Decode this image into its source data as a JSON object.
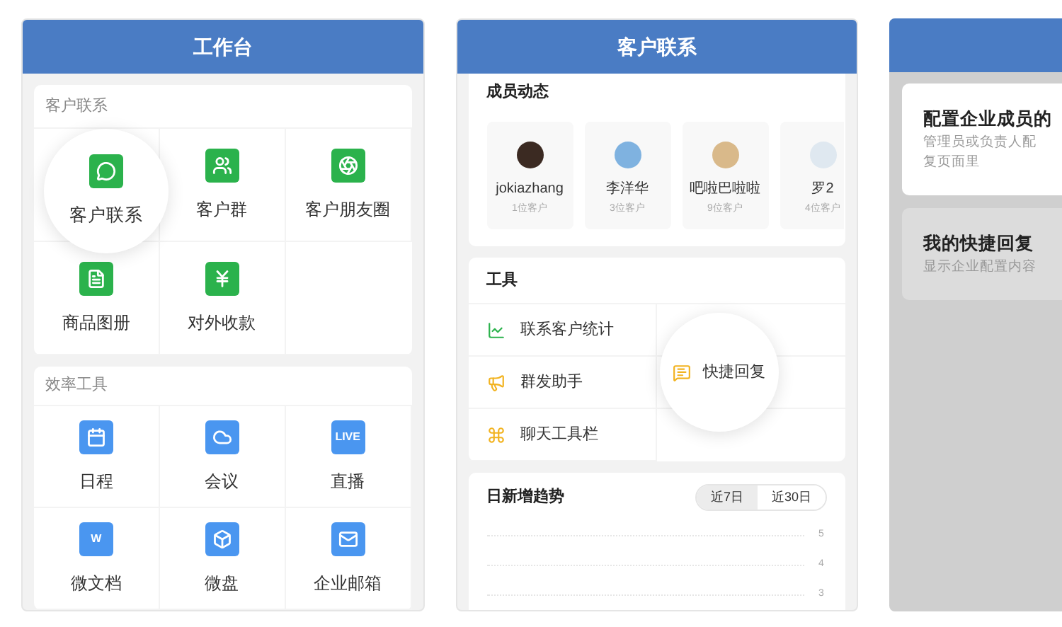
{
  "workbench": {
    "title": "工作台",
    "sections": [
      {
        "heading": "客户联系",
        "items": [
          {
            "label": "客户联系",
            "spotlight": true
          },
          {
            "label": "客户群",
            "spotlight": false
          },
          {
            "label": "客户朋友圈",
            "spotlight": false
          },
          {
            "label": "商品图册",
            "spotlight": false
          },
          {
            "label": "对外收款",
            "spotlight": false
          }
        ]
      },
      {
        "heading": "效率工具",
        "items": [
          {
            "label": "日程",
            "spotlight": false
          },
          {
            "label": "会议",
            "spotlight": false
          },
          {
            "label": "直播",
            "spotlight": false,
            "icon_text": "LIVE"
          },
          {
            "label": "微文档",
            "spotlight": false,
            "icon_text": "W"
          },
          {
            "label": "微盘",
            "spotlight": false
          },
          {
            "label": "企业邮箱",
            "spotlight": false
          }
        ]
      }
    ]
  },
  "customer_contact": {
    "title": "客户联系",
    "members": {
      "heading": "成员动态",
      "items": [
        {
          "name": "jokiazhang",
          "count": "1位客户",
          "color": "#3b2a22"
        },
        {
          "name": "李洋华",
          "count": "3位客户",
          "color": "#7fb2e0"
        },
        {
          "name": "吧啦巴啦啦",
          "count": "9位客户",
          "color": "#d9b98a"
        },
        {
          "name": "罗2",
          "count": "4位客户",
          "color": "#dfe8f0"
        }
      ]
    },
    "tools": {
      "heading": "工具",
      "items": [
        {
          "label": "联系客户统计",
          "spotlight": false
        },
        {
          "label": "群发助手",
          "spotlight": false
        },
        {
          "label": "快捷回复",
          "spotlight": true
        },
        {
          "label": "聊天工具栏",
          "spotlight": false
        }
      ]
    },
    "trend": {
      "title": "日新增趋势",
      "ranges": [
        {
          "label": "近7日",
          "selected": true
        },
        {
          "label": "近30日",
          "selected": false
        }
      ],
      "y_axis_labels": [
        "5",
        "4",
        "3"
      ]
    }
  },
  "quick_reply": {
    "cards": [
      {
        "title": "配置企业成员的",
        "lines": [
          "管理员或负责人配",
          "复页面里"
        ],
        "dimmed": false
      },
      {
        "title": "我的快捷回复",
        "lines": [
          "显示企业配置内容"
        ],
        "dimmed": true
      }
    ]
  }
}
